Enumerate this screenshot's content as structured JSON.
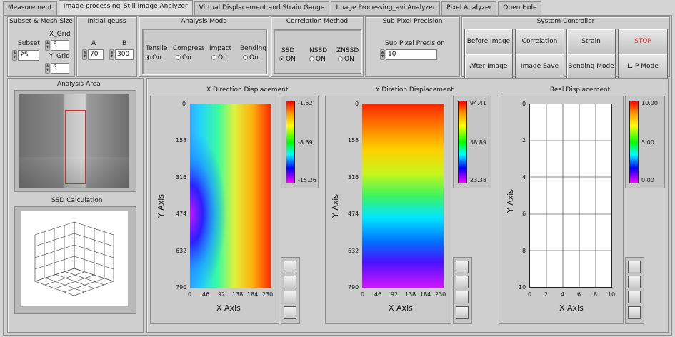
{
  "tabs": [
    {
      "label": "Measurement"
    },
    {
      "label": "Image processing_Still Image Analyzer"
    },
    {
      "label": "Virtual Displacement and Strain Gauge"
    },
    {
      "label": "Image Processing_avi Analyzer"
    },
    {
      "label": "Pixel Analyzer"
    },
    {
      "label": "Open Hole"
    }
  ],
  "subset_mesh": {
    "title": "Subset  & Mesh Size",
    "subset_label": "Subset",
    "subset_value": "25",
    "xgrid_label": "X_Grid",
    "xgrid_value": "5",
    "ygrid_label": "Y_Grid",
    "ygrid_value": "5"
  },
  "initial_guess": {
    "title": "Initial geuss",
    "a_label": "A",
    "a_value": "70",
    "b_label": "B",
    "b_value": "300"
  },
  "analysis_mode": {
    "title": "Analysis Mode",
    "options": [
      {
        "label": "Tensile",
        "state": "On",
        "selected": true
      },
      {
        "label": "Compress",
        "state": "On",
        "selected": false
      },
      {
        "label": "Impact",
        "state": "On",
        "selected": false
      },
      {
        "label": "Bending",
        "state": "On",
        "selected": false
      }
    ]
  },
  "correlation_method": {
    "title": "Correlation Method",
    "options": [
      {
        "label": "SSD",
        "state": "ON",
        "selected": true
      },
      {
        "label": "NSSD",
        "state": "ON",
        "selected": false
      },
      {
        "label": "ZNSSD",
        "state": "ON",
        "selected": false
      }
    ]
  },
  "subpixel": {
    "title": "Sub Pixel Precision",
    "field_label": "Sub Pixel Precision",
    "value": "10"
  },
  "system_controller": {
    "title": "System Controller",
    "buttons": {
      "before_image": "Before Image",
      "correlation": "Correlation",
      "strain": "Strain",
      "stop": "STOP",
      "after_image": "After Image",
      "image_save": "Image Save",
      "bending_mode": "Bending Mode",
      "lp_mode": "L. P Mode"
    },
    "stop_color": "#e8201a"
  },
  "analysis_area": {
    "title": "Analysis Area"
  },
  "ssd_calc": {
    "title": "SSD Calculation"
  },
  "plots": {
    "x_disp": {
      "title": "X Direction Displacement",
      "xlabel": "X Axis",
      "ylabel": "Y Axis",
      "xticks": [
        "0",
        "46",
        "92",
        "138",
        "184",
        "230"
      ],
      "yticks": [
        "0",
        "158",
        "316",
        "474",
        "632",
        "790"
      ],
      "scale": [
        "-1.52",
        "-8.39",
        "-15.26"
      ]
    },
    "y_disp": {
      "title": "Y Diretion Displacement",
      "xlabel": "X Axis",
      "ylabel": "Y Axis",
      "xticks": [
        "0",
        "46",
        "92",
        "138",
        "184",
        "230"
      ],
      "yticks": [
        "0",
        "158",
        "316",
        "474",
        "632",
        "790"
      ],
      "scale": [
        "94.41",
        "58.89",
        "23.38"
      ]
    },
    "real_disp": {
      "title": "Real Displacement",
      "xlabel": "X Axis",
      "ylabel": "Y Axis",
      "xticks": [
        "0",
        "2",
        "4",
        "6",
        "8",
        "10"
      ],
      "yticks": [
        "0",
        "2",
        "4",
        "6",
        "8",
        "10"
      ],
      "scale": [
        "10.00",
        "5.00",
        "0.00"
      ]
    }
  },
  "icons": [
    "zoom-icon",
    "pan-icon",
    "cursor-move-icon",
    "axis-scale-icon"
  ]
}
